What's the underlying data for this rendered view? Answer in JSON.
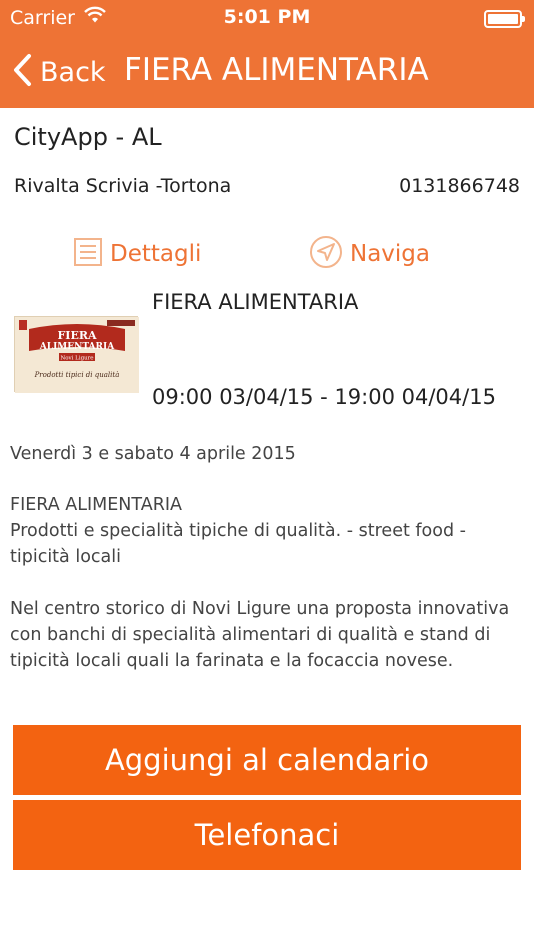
{
  "status_bar": {
    "carrier": "Carrier",
    "time": "5:01 PM"
  },
  "nav": {
    "back_label": "Back",
    "title": "FIERA ALIMENTARIA"
  },
  "venue": {
    "app_name": "CityApp - AL",
    "location": "Rivalta Scrivia -Tortona",
    "phone": "0131866748"
  },
  "actions": {
    "details_label": "Dettagli",
    "navigate_label": "Naviga"
  },
  "event": {
    "title": "FIERA ALIMENTARIA",
    "datetime": "09:00 03/04/15 - 19:00 04/04/15",
    "image_text": {
      "line1": "FIERA",
      "line2": "ALIMENTARIA",
      "line3": "Novi Ligure",
      "line4": "Prodotti tipici di qualità"
    }
  },
  "description": {
    "date_line": "Venerdì 3 e sabato 4 aprile 2015",
    "title_line": "FIERA ALIMENTARIA",
    "products": "Prodotti e specialità tipiche di qualità. - street  food - tipicità locali",
    "body": "Nel centro storico di Novi Ligure una proposta innovativa con  banchi di specialità alimentari di qualità e stand di tipicità locali quali la farinata e la focaccia novese."
  },
  "buttons": {
    "calendar_label": "Aggiungi al calendario",
    "phone_label": "Telefonaci"
  },
  "colors": {
    "header": "#ee7335",
    "accent": "#ee7335",
    "button": "#f36311"
  }
}
